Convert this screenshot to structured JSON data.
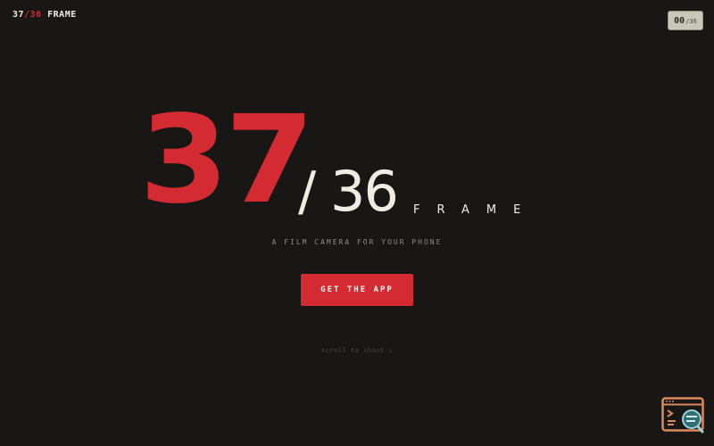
{
  "logo": {
    "num": "37",
    "slash_den": "/36",
    "name": "FRAME"
  },
  "counter": {
    "current": "00",
    "total": "/36"
  },
  "hero": {
    "big_number": "37",
    "slash": "/",
    "denominator": "36",
    "word": "FRAME"
  },
  "tagline": "A FILM CAMERA FOR YOUR PHONE",
  "cta": {
    "label": "GET THE APP"
  },
  "scroll_hint": "scroll to shoot ↓",
  "colors": {
    "background": "#181716",
    "accent": "#d42a32",
    "text": "#f1ece2",
    "muted": "#8f8a82",
    "counter_bg": "#c7c8b7",
    "widget_orange": "#d98a5a",
    "widget_teal": "#2f6f78"
  },
  "icons": {
    "widget": "terminal-search-icon"
  }
}
